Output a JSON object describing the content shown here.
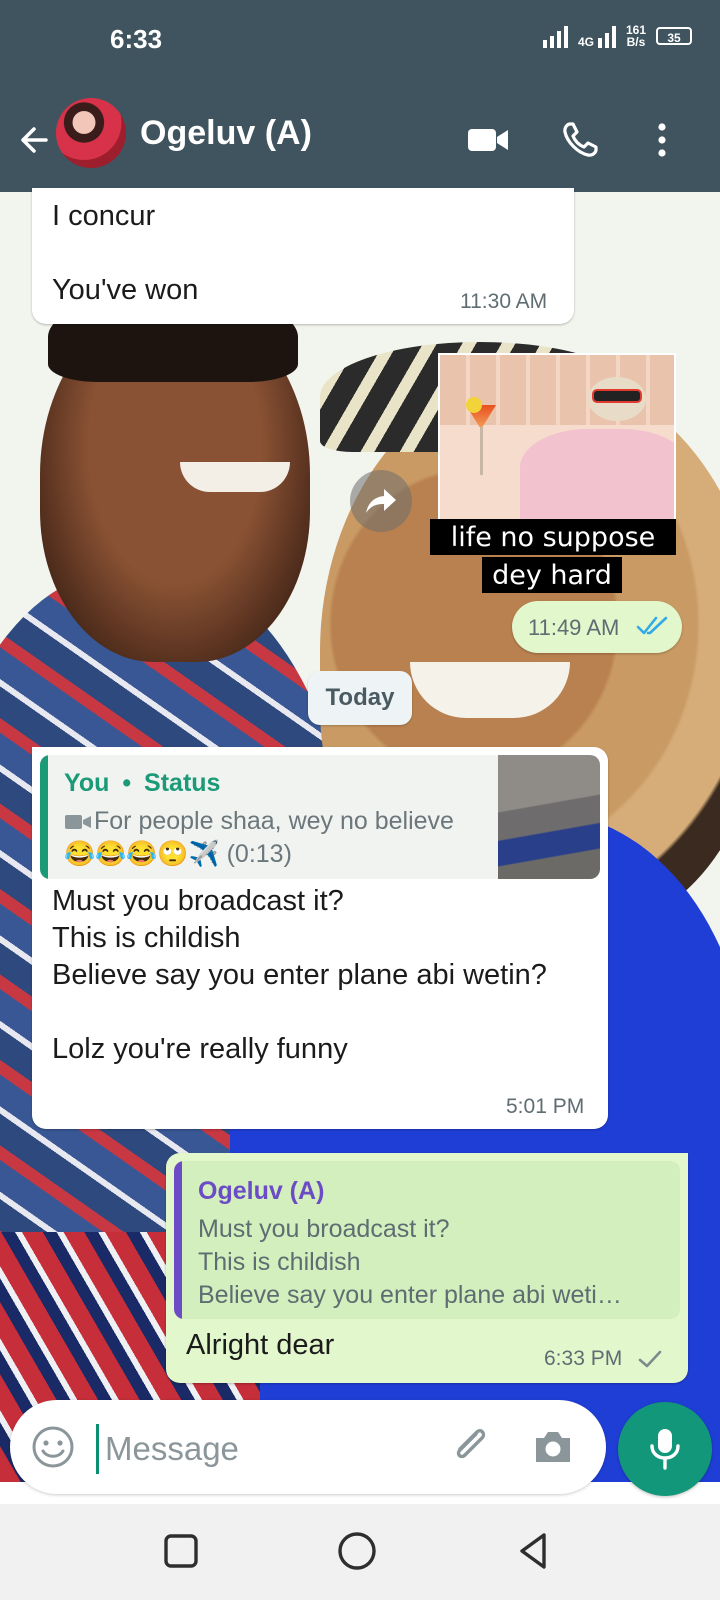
{
  "status_bar": {
    "time": "6:33",
    "network_type": "4G",
    "net_speed_value": "161",
    "net_speed_unit": "B/s",
    "battery": "35"
  },
  "header": {
    "contact_name": "Ogeluv (A)",
    "icons": [
      "back-arrow-icon",
      "video-call-icon",
      "phone-icon",
      "more-vert-icon"
    ]
  },
  "messages": [
    {
      "direction": "incoming",
      "text": "I concur\n\nYou've won",
      "time": "11:30 AM"
    },
    {
      "direction": "outgoing",
      "sticker_caption_line1": "life no suppose",
      "sticker_caption_line2": "dey hard",
      "time": "11:49 AM",
      "status": "read"
    }
  ],
  "date_separator": "Today",
  "status_reply": {
    "author": "You",
    "separator": "•",
    "source": "Status",
    "preview_text": "For people shaa, wey no believe😂😂😂🙄✈️ (0:13)",
    "message_text": "Must you broadcast it?\nThis is childish\nBelieve say you enter plane abi wetin?\n\nLolz you're really funny",
    "time": "5:01 PM"
  },
  "quoted_reply": {
    "quoted_author": "Ogeluv (A)",
    "quoted_text": "Must you broadcast it?\nThis is childish\nBelieve say you enter plane abi weti…",
    "message_text": "Alright dear",
    "time": "6:33 PM",
    "status": "sent"
  },
  "composer": {
    "placeholder": "Message"
  },
  "colors": {
    "header_bg": "#3f545e",
    "outgoing_bubble": "#e2f8cc",
    "incoming_bubble": "#ffffff",
    "accent_green": "#12977a",
    "read_tick_blue": "#34a9e8",
    "status_author_green": "#1a9a77",
    "quote_author_purple": "#6b4cc6"
  }
}
